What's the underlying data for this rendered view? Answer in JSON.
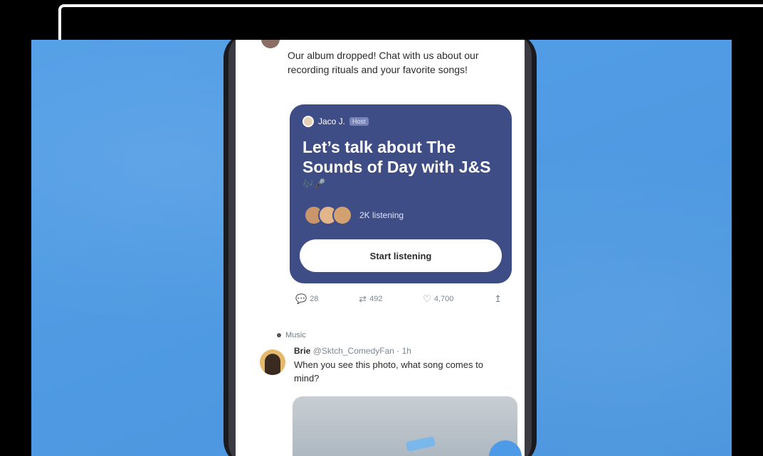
{
  "tweet1": {
    "text": "Our album dropped! Chat with us about our recording rituals and your favorite songs!"
  },
  "space_card": {
    "host_name": "Jaco J.",
    "host_badge": "Host",
    "title": "Let’s talk about The Sounds of Day with J&S",
    "emojis": "🎶🎤",
    "listeners_text": "2K listening",
    "start_button": "Start listening"
  },
  "tweet_actions": {
    "reply_count": "28",
    "retweet_count": "492",
    "like_count": "4,700"
  },
  "topic_label": "Music",
  "tweet2": {
    "name": "Brie",
    "handle_time": "@Sktch_ComedyFan · 1h",
    "text": "When you see this photo, what song comes to mind?"
  },
  "colors": {
    "background_blue": "#4d9be6",
    "space_card": "#3f4d86"
  },
  "icons": [
    "reply-icon",
    "retweet-icon",
    "like-icon",
    "share-icon",
    "compose-icon"
  ]
}
